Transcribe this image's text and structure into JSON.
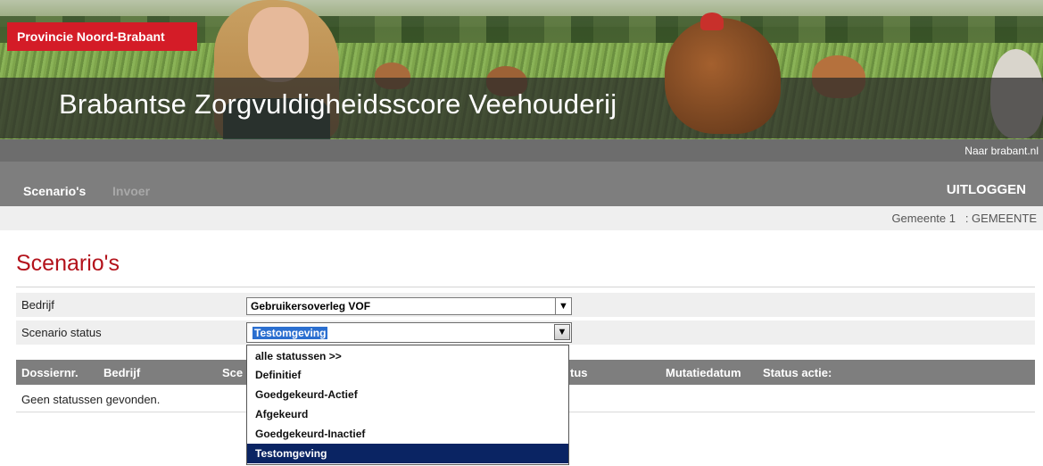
{
  "header": {
    "brand": "Provincie Noord-Brabant",
    "site_title": "Brabantse Zorgvuldigheidsscore Veehouderij",
    "external_link": "Naar brabant.nl"
  },
  "nav": {
    "items": [
      {
        "label": "Scenario's",
        "active": true
      },
      {
        "label": "Invoer",
        "active": false
      }
    ],
    "logout": "UITLOGGEN"
  },
  "user_info": "Gemeente 1   : GEMEENTE",
  "page": {
    "title": "Scenario's",
    "filters": {
      "bedrijf_label": "Bedrijf",
      "bedrijf_value": "Gebruikersoverleg VOF",
      "status_label": "Scenario status",
      "status_value": "Testomgeving"
    },
    "table": {
      "headers": [
        "Dossiernr.",
        "Bedrijf",
        "Sce",
        "tus",
        "Mutatiedatum",
        "Status actie:"
      ],
      "empty_message": "Geen statussen gevonden."
    },
    "status_options": [
      "alle statussen >>",
      "Definitief",
      "Goedgekeurd-Actief",
      "Afgekeurd",
      "Goedgekeurd-Inactief",
      "Testomgeving"
    ],
    "selected_option_index": 5
  },
  "colors": {
    "brand_red": "#d41c27",
    "title_red": "#b3121b",
    "nav_gray": "#7e7e7e",
    "selection_navy": "#0a2463"
  }
}
